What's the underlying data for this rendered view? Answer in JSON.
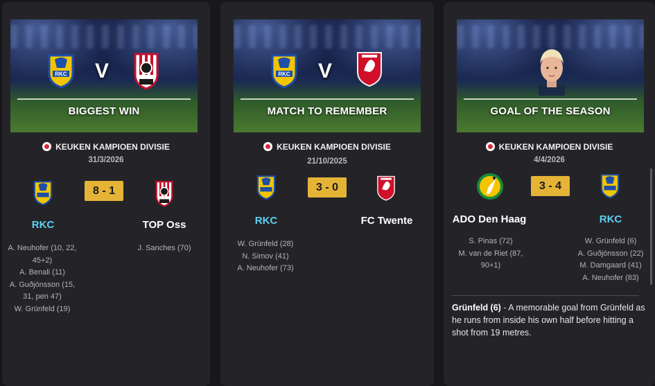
{
  "cards": [
    {
      "banner_title": "BIGGEST WIN",
      "vs": "V",
      "league": "KEUKEN KAMPIOEN DIVISIE",
      "date": "31/3/2026",
      "score": "8 - 1",
      "home_team": "RKC",
      "away_team": "TOP Oss",
      "home_scorers": [
        "A. Neuhofer (10, 22,",
        "45+2)",
        "A. Benali (11)",
        "A. Guðjónsson (15,",
        "31, pen 47)",
        "W. Grünfeld (19)"
      ],
      "away_scorers": [
        "J. Sanches (70)"
      ]
    },
    {
      "banner_title": "MATCH TO REMEMBER",
      "vs": "V",
      "league": "KEUKEN KAMPIOEN DIVISIE",
      "date": "21/10/2025",
      "score": "3 - 0",
      "home_team": "RKC",
      "away_team": "FC Twente",
      "home_scorers": [
        "W. Grünfeld (28)",
        "N. Simov (41)",
        "A. Neuhofer (73)"
      ],
      "away_scorers": []
    },
    {
      "banner_title": "GOAL OF THE SEASON",
      "league": "KEUKEN KAMPIOEN DIVISIE",
      "date": "4/4/2026",
      "score": "3 - 4",
      "home_team": "ADO Den Haag",
      "away_team": "RKC",
      "home_scorers": [
        "S. Pinas (72)",
        "M. van de Riet (87,",
        "90+1)"
      ],
      "away_scorers": [
        "W. Grünfeld (6)",
        "A. Guðjónsson (22)",
        "M. Damgaard (41)",
        "A. Neuhofer (83)"
      ],
      "goal_scorer": "Grünfeld (6)",
      "goal_text": " - A memorable goal from Grünfeld as he runs from inside his own half before hitting a shot from 19 metres."
    }
  ],
  "colors": {
    "card_bg": "#242428",
    "score_bg": "#e5b437",
    "highlight_team": "#5fd0f0"
  },
  "icons": {
    "rkc": "rkc-crest-icon",
    "top_oss": "top-oss-crest-icon",
    "fc_twente": "fc-twente-crest-icon",
    "ado": "ado-den-haag-crest-icon",
    "league": "keuken-kampioen-divisie-icon"
  }
}
